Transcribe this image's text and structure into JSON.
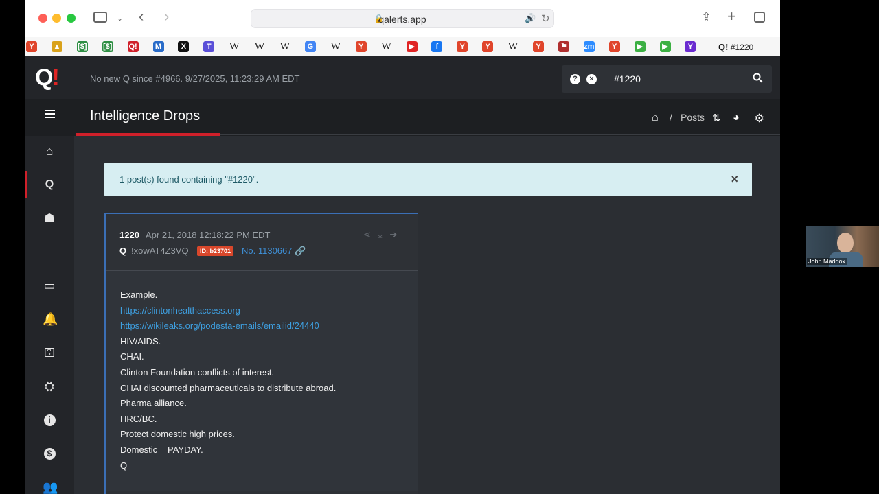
{
  "browser": {
    "url": "qalerts.app",
    "tab_title": "#1220",
    "favorites": [
      {
        "icon": "Y",
        "color": "#e0452b"
      },
      {
        "icon": "▲",
        "color": "#d9a21b"
      },
      {
        "icon": "[$]",
        "color": "#2f8f44"
      },
      {
        "icon": "[$]",
        "color": "#2f8f44"
      },
      {
        "icon": "Q!",
        "color": "#d0202a"
      },
      {
        "icon": "M",
        "color": "#2a6cc9"
      },
      {
        "icon": "X",
        "color": "#111111"
      },
      {
        "icon": "T",
        "color": "#5a4fd8"
      },
      {
        "icon": "W",
        "color": "#222222"
      },
      {
        "icon": "W",
        "color": "#222222"
      },
      {
        "icon": "W",
        "color": "#222222"
      },
      {
        "icon": "G",
        "color": "#4285f4"
      },
      {
        "icon": "W",
        "color": "#222222"
      },
      {
        "icon": "Y",
        "color": "#e0452b"
      },
      {
        "icon": "W",
        "color": "#222222"
      },
      {
        "icon": "▶",
        "color": "#e02424"
      },
      {
        "icon": "f",
        "color": "#1877f2"
      },
      {
        "icon": "Y",
        "color": "#e0452b"
      },
      {
        "icon": "Y",
        "color": "#e0452b"
      },
      {
        "icon": "W",
        "color": "#222222"
      },
      {
        "icon": "Y",
        "color": "#e0452b"
      },
      {
        "icon": "⚑",
        "color": "#b03030"
      },
      {
        "icon": "zm",
        "color": "#2d8cff"
      },
      {
        "icon": "Y",
        "color": "#e0452b"
      },
      {
        "icon": "▶",
        "color": "#3cb043"
      },
      {
        "icon": "▶",
        "color": "#3cb043"
      },
      {
        "icon": "Y",
        "color": "#6a2bd0"
      }
    ]
  },
  "site": {
    "logo": "Q",
    "logo_mark": "!",
    "status": "No new Q since #4966. 9/27/2025, 11:23:29 AM EDT",
    "search_value": "#1220",
    "page_title": "Intelligence Drops",
    "breadcrumb": "Posts",
    "sidebar": [
      {
        "name": "home",
        "icon": "⌂"
      },
      {
        "name": "q",
        "icon": "Q"
      },
      {
        "name": "android",
        "icon": "☗"
      },
      {
        "name": "apple",
        "icon": ""
      },
      {
        "name": "desktop",
        "icon": "▭"
      },
      {
        "name": "bell",
        "icon": "🔔"
      },
      {
        "name": "key",
        "icon": "⚿"
      },
      {
        "name": "toolbox",
        "icon": "⛭"
      },
      {
        "name": "info",
        "icon": "i"
      },
      {
        "name": "donate",
        "icon": "$"
      },
      {
        "name": "users",
        "icon": "👥"
      }
    ]
  },
  "alert": {
    "text": "1 post(s) found containing \"#1220\"."
  },
  "post": {
    "number": "1220",
    "date": "Apr 21, 2018 12:18:22 PM EDT",
    "author": "Q",
    "tripcode": "!xowAT4Z3VQ",
    "id_badge": "ID: b23701",
    "post_no": "No. 1130667",
    "lines": [
      {
        "text": "Example.",
        "link": false
      },
      {
        "text": "https://clintonhealthaccess.org",
        "link": true
      },
      {
        "text": "https://wikileaks.org/podesta-emails/emailid/24440",
        "link": true
      },
      {
        "text": "HIV/AIDS.",
        "link": false
      },
      {
        "text": "CHAI.",
        "link": false
      },
      {
        "text": "Clinton Foundation conflicts of interest.",
        "link": false
      },
      {
        "text": "CHAI discounted pharmaceuticals to distribute abroad.",
        "link": false
      },
      {
        "text": "Pharma alliance.",
        "link": false
      },
      {
        "text": "HRC/BC.",
        "link": false
      },
      {
        "text": "Protect domestic high prices.",
        "link": false
      },
      {
        "text": "Domestic = PAYDAY.",
        "link": false
      },
      {
        "text": "Q",
        "link": false
      }
    ]
  },
  "webcam": {
    "name": "John Maddox"
  }
}
